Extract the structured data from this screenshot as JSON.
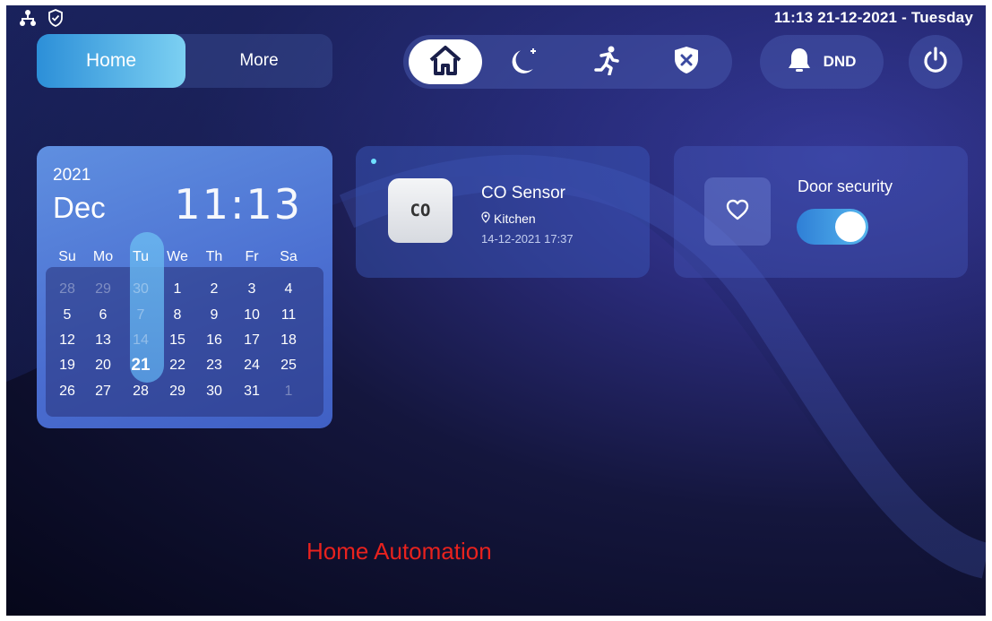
{
  "status_bar": {
    "network_icon": "network-tree-icon",
    "shield_icon": "shield-check-icon",
    "datetime": "11:13 21-12-2021 - Tuesday"
  },
  "tabs": {
    "home": "Home",
    "more": "More"
  },
  "modes": [
    {
      "name": "home-mode",
      "icon": "house-icon",
      "active": true
    },
    {
      "name": "sleep-mode",
      "icon": "moon-icon",
      "active": false
    },
    {
      "name": "away-mode",
      "icon": "running-person-icon",
      "active": false
    },
    {
      "name": "disarm-mode",
      "icon": "shield-x-icon",
      "active": false
    }
  ],
  "dnd": {
    "label": "DND",
    "icon": "bell-icon"
  },
  "power": {
    "icon": "power-icon"
  },
  "calendar": {
    "year": "2021",
    "month": "Dec",
    "time": "11:13",
    "weekdays": [
      "Su",
      "Mo",
      "Tu",
      "We",
      "Th",
      "Fr",
      "Sa"
    ],
    "weeks": [
      [
        "28",
        "29",
        "30",
        "1",
        "2",
        "3",
        "4"
      ],
      [
        "5",
        "6",
        "7",
        "8",
        "9",
        "10",
        "11"
      ],
      [
        "12",
        "13",
        "14",
        "15",
        "16",
        "17",
        "18"
      ],
      [
        "19",
        "20",
        "21",
        "22",
        "23",
        "24",
        "25"
      ],
      [
        "26",
        "27",
        "28",
        "29",
        "30",
        "31",
        "1"
      ]
    ],
    "today": "21"
  },
  "co_sensor": {
    "icon_text": "CO",
    "title": "CO Sensor",
    "location": "Kitchen",
    "timestamp": "14-12-2021 17:37"
  },
  "door_security": {
    "title": "Door security",
    "icon": "heart-icon",
    "enabled": true
  },
  "caption": "Home Automation",
  "colors": {
    "accent": "#2c8fd8",
    "caption_red": "#e8221e",
    "background_dark": "#06071a"
  }
}
